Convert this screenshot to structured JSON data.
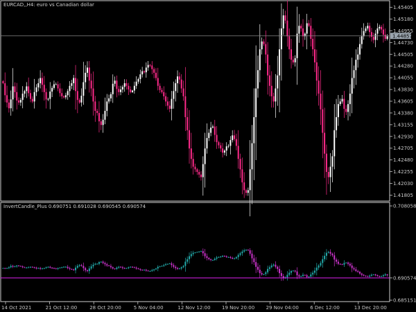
{
  "main_panel": {
    "symbol_label": "EURCAD,,H4:  euro vs Canadian dollar",
    "current_price_tag": "1.44857",
    "price_ticks": [
      "1.45405",
      "1.45180",
      "1.44955",
      "1.44730",
      "1.44505",
      "1.44280",
      "1.44055",
      "1.43830",
      "1.43605",
      "1.43380",
      "1.43155",
      "1.42930",
      "1.42705",
      "1.42480",
      "1.42255",
      "1.42030",
      "1.41805"
    ],
    "price_range": [
      1.41705,
      1.45505
    ],
    "horizontal_line_price": 1.44857
  },
  "indicator_panel": {
    "label": "InvertCandle_Plus 0.690751 0.691028 0.690545 0.690574",
    "value_ticks": [
      "0.708058",
      "0.690574",
      "0.685151"
    ],
    "current_value_tag": "0.690574",
    "value_range": [
      0.685151,
      0.708058
    ],
    "horizontal_line_value": 0.690574
  },
  "time_axis": {
    "labels": [
      "14 Oct 2021",
      "21 Oct 12:00",
      "28 Oct 20:00",
      "5 Nov 04:00",
      "12 Nov 12:00",
      "19 Nov 20:00",
      "29 Nov 04:00",
      "6 Dec 12:00",
      "13 Dec 20:00"
    ]
  },
  "colors": {
    "background": "#000000",
    "candle_bull": "#ffffff",
    "candle_bear": "#ff2a8a",
    "indicator_up": "#22aaaa",
    "indicator_down": "#cc33cc",
    "indicator_line": "#dd22ee",
    "grid_line": "#888888",
    "price_tag_bg": "#9aa4ae"
  },
  "chart_data": {
    "type": "candlestick",
    "series": [
      {
        "values": [
          1.4395,
          1.4372,
          1.4358,
          1.4347,
          1.4364,
          1.4389,
          1.4378,
          1.4362,
          1.4358,
          1.4363,
          1.4375,
          1.438,
          1.4389,
          1.4376,
          1.4365,
          1.436,
          1.4378,
          1.4387,
          1.4395,
          1.4405,
          1.4392,
          1.4378,
          1.4364,
          1.4365,
          1.4379,
          1.4386,
          1.4393,
          1.4393,
          1.4385,
          1.4376,
          1.437,
          1.4368,
          1.4372,
          1.438,
          1.439,
          1.4395,
          1.4405,
          1.438,
          1.4363,
          1.4358,
          1.4371,
          1.4397,
          1.4415,
          1.4425,
          1.44,
          1.4385,
          1.436,
          1.4342,
          1.4338,
          1.4322,
          1.4315,
          1.4325,
          1.4342,
          1.436,
          1.4366,
          1.4374,
          1.4394,
          1.44,
          1.4384,
          1.4378,
          1.4383,
          1.4388,
          1.4395,
          1.439,
          1.4383,
          1.4378,
          1.4381,
          1.439,
          1.4398,
          1.4403,
          1.4412,
          1.4418,
          1.4416,
          1.4425,
          1.443,
          1.4429,
          1.4422,
          1.4415,
          1.4405,
          1.439,
          1.4382,
          1.4378,
          1.437,
          1.436,
          1.4352,
          1.4346,
          1.4365,
          1.438,
          1.4395,
          1.4408,
          1.4402,
          1.4385,
          1.437,
          1.433,
          1.4305,
          1.427,
          1.425,
          1.4235,
          1.423,
          1.4225,
          1.422,
          1.4215,
          1.424,
          1.427,
          1.429,
          1.43,
          1.431,
          1.4312,
          1.4296,
          1.4282,
          1.4276,
          1.427,
          1.4262,
          1.4266,
          1.4274,
          1.4275,
          1.4286,
          1.4295,
          1.4288,
          1.4275,
          1.425,
          1.423,
          1.4205,
          1.419,
          1.4185,
          1.419,
          1.423,
          1.428,
          1.433,
          1.4385,
          1.442,
          1.446,
          1.4475,
          1.447,
          1.445,
          1.441,
          1.439,
          1.437,
          1.436,
          1.4385,
          1.441,
          1.446,
          1.45,
          1.4525,
          1.4515,
          1.4485,
          1.446,
          1.444,
          1.4435,
          1.4443,
          1.449,
          1.4505,
          1.45,
          1.4485,
          1.449,
          1.451,
          1.4505,
          1.448,
          1.446,
          1.4435,
          1.44,
          1.4375,
          1.4345,
          1.43,
          1.426,
          1.4225,
          1.4215,
          1.4235,
          1.4255,
          1.4305,
          1.433,
          1.4355,
          1.436,
          1.4365,
          1.4346,
          1.434,
          1.4355,
          1.4375,
          1.4405,
          1.442,
          1.444,
          1.445,
          1.447,
          1.4485,
          1.4495,
          1.45,
          1.4505,
          1.4493,
          1.4484,
          1.4478,
          1.449,
          1.45,
          1.4503,
          1.4498,
          1.4488,
          1.448,
          1.4485
        ]
      }
    ],
    "indicator_series": [
      {
        "values": [
          0.6929,
          0.6928,
          0.6929,
          0.6931,
          0.6934,
          0.6932,
          0.6933,
          0.6935,
          0.6934,
          0.6933,
          0.6931,
          0.693,
          0.693,
          0.6931,
          0.6932,
          0.6931,
          0.693,
          0.6928,
          0.6929,
          0.6927,
          0.6928,
          0.6929,
          0.6931,
          0.6932,
          0.693,
          0.6929,
          0.6928,
          0.6927,
          0.6929,
          0.693,
          0.6931,
          0.6932,
          0.6932,
          0.6929,
          0.6927,
          0.6926,
          0.6924,
          0.693,
          0.6934,
          0.6936,
          0.6934,
          0.6929,
          0.6924,
          0.6922,
          0.6928,
          0.6933,
          0.6937,
          0.6939,
          0.6939,
          0.6943,
          0.6944,
          0.6941,
          0.6938,
          0.6935,
          0.6934,
          0.6931,
          0.6928,
          0.6927,
          0.693,
          0.6932,
          0.6931,
          0.6929,
          0.6928,
          0.6929,
          0.6931,
          0.6932,
          0.6931,
          0.693,
          0.6928,
          0.6927,
          0.6925,
          0.6924,
          0.6925,
          0.6923,
          0.6922,
          0.6922,
          0.6924,
          0.6926,
          0.6928,
          0.6932,
          0.6933,
          0.6934,
          0.6936,
          0.6938,
          0.6939,
          0.694,
          0.6936,
          0.6932,
          0.6929,
          0.6927,
          0.6928,
          0.6931,
          0.6934,
          0.6944,
          0.695,
          0.6957,
          0.6962,
          0.6965,
          0.6966,
          0.6967,
          0.6968,
          0.6969,
          0.6964,
          0.6957,
          0.6953,
          0.695,
          0.6948,
          0.6948,
          0.6951,
          0.6954,
          0.6955,
          0.6956,
          0.6958,
          0.6957,
          0.6955,
          0.6955,
          0.6953,
          0.6951,
          0.6952,
          0.6955,
          0.696,
          0.6964,
          0.6968,
          0.6971,
          0.6972,
          0.6971,
          0.6963,
          0.6952,
          0.6943,
          0.6932,
          0.6925,
          0.6917,
          0.6914,
          0.6915,
          0.6919,
          0.6927,
          0.6931,
          0.6935,
          0.6937,
          0.6932,
          0.6927,
          0.6917,
          0.691,
          0.6905,
          0.6907,
          0.6913,
          0.6918,
          0.6922,
          0.6923,
          0.6921,
          0.6912,
          0.6909,
          0.691,
          0.6913,
          0.6912,
          0.6908,
          0.6909,
          0.6914,
          0.6918,
          0.6923,
          0.693,
          0.6935,
          0.6941,
          0.695,
          0.6958,
          0.6965,
          0.6967,
          0.6963,
          0.6959,
          0.6949,
          0.6944,
          0.6939,
          0.6938,
          0.6937,
          0.6941,
          0.6942,
          0.6939,
          0.6935,
          0.6929,
          0.6926,
          0.6922,
          0.692,
          0.6916,
          0.6913,
          0.6911,
          0.691,
          0.6909,
          0.6911,
          0.6913,
          0.6914,
          0.6912,
          0.691,
          0.6909,
          0.691,
          0.6912,
          0.6914,
          0.6912
        ]
      }
    ]
  }
}
